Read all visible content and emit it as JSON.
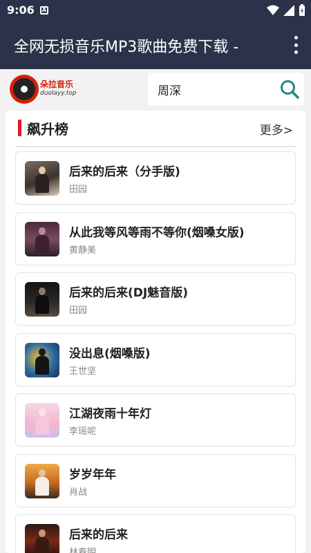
{
  "status_bar": {
    "time": "9:06",
    "sim_label": "A"
  },
  "app_bar": {
    "title": "全网无损音乐MP3歌曲免费下载 -"
  },
  "logo": {
    "name": "朵拉音乐",
    "url": "duolayy.top"
  },
  "search": {
    "value": "周深"
  },
  "section": {
    "title": "飙升榜",
    "more_label": "更多>"
  },
  "songs": [
    {
      "title": "后来的后来（分手版)",
      "artist": "田园"
    },
    {
      "title": "从此我等风等雨不等你(烟嗓女版)",
      "artist": "黄静美"
    },
    {
      "title": "后来的后来(DJ魅音版)",
      "artist": "田园"
    },
    {
      "title": "没出息(烟嗓版)",
      "artist": "王世坚"
    },
    {
      "title": "江湖夜雨十年灯",
      "artist": "李瑶呢"
    },
    {
      "title": "岁岁年年",
      "artist": "肖战"
    },
    {
      "title": "后来的后来",
      "artist": "林春明"
    }
  ],
  "colors": {
    "app_bar": "#2b3249",
    "accent": "#e31b23",
    "search_icon": "#1f8a78"
  }
}
